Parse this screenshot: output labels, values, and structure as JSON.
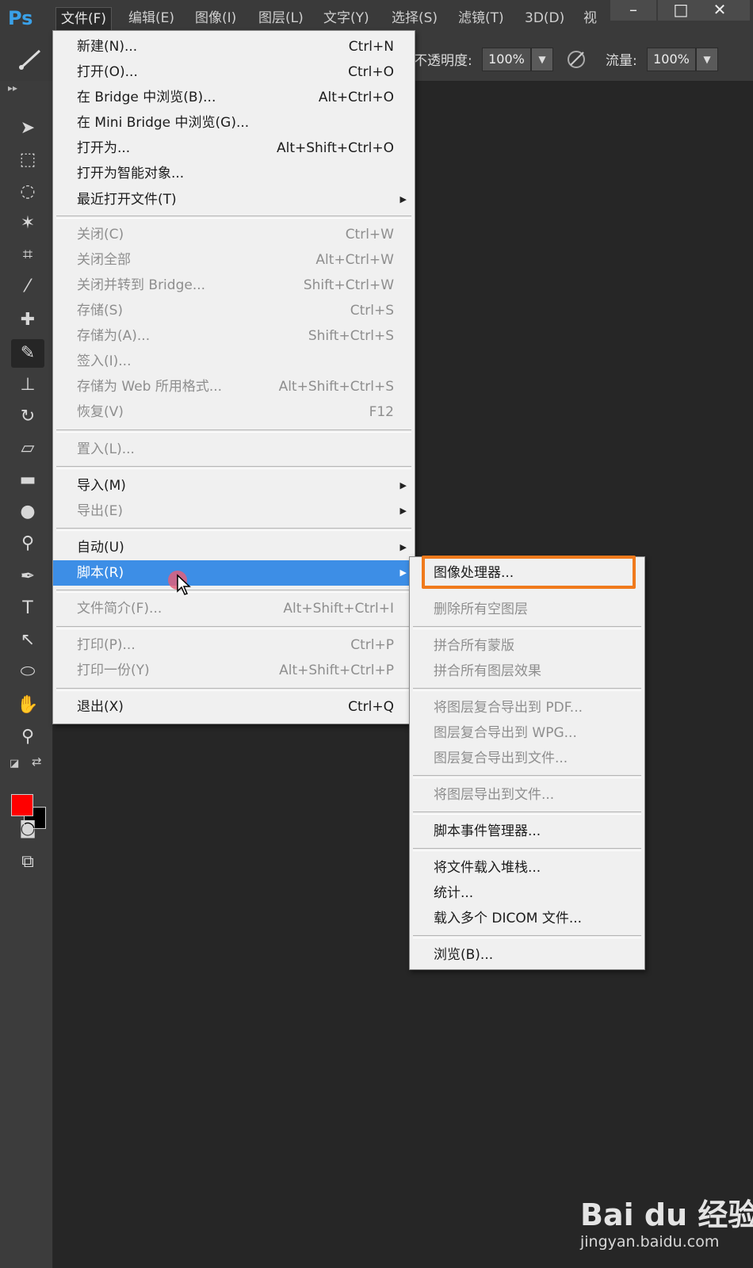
{
  "app": {
    "logo": "Ps"
  },
  "menubar": {
    "items": [
      "文件(F)",
      "编辑(E)",
      "图像(I)",
      "图层(L)",
      "文字(Y)",
      "选择(S)",
      "滤镜(T)",
      "3D(D)",
      "视"
    ],
    "active_index": 0
  },
  "window_controls": {
    "minimize": "–",
    "maximize": "□",
    "close": "✕"
  },
  "options_bar": {
    "opacity_label": "不透明度:",
    "opacity_value": "100%",
    "flow_label": "流量:",
    "flow_value": "100%"
  },
  "file_menu": {
    "items": [
      {
        "label": "新建(N)...",
        "shortcut": "Ctrl+N"
      },
      {
        "label": "打开(O)...",
        "shortcut": "Ctrl+O"
      },
      {
        "label": "在 Bridge 中浏览(B)...",
        "shortcut": "Alt+Ctrl+O"
      },
      {
        "label": "在 Mini Bridge 中浏览(G)...",
        "shortcut": ""
      },
      {
        "label": "打开为...",
        "shortcut": "Alt+Shift+Ctrl+O"
      },
      {
        "label": "打开为智能对象...",
        "shortcut": ""
      },
      {
        "label": "最近打开文件(T)",
        "shortcut": "",
        "submenu": true
      },
      {
        "label": "关闭(C)",
        "shortcut": "Ctrl+W",
        "disabled": true
      },
      {
        "label": "关闭全部",
        "shortcut": "Alt+Ctrl+W",
        "disabled": true
      },
      {
        "label": "关闭并转到 Bridge...",
        "shortcut": "Shift+Ctrl+W",
        "disabled": true
      },
      {
        "label": "存储(S)",
        "shortcut": "Ctrl+S",
        "disabled": true
      },
      {
        "label": "存储为(A)...",
        "shortcut": "Shift+Ctrl+S",
        "disabled": true
      },
      {
        "label": "签入(I)...",
        "shortcut": "",
        "disabled": true
      },
      {
        "label": "存储为 Web 所用格式...",
        "shortcut": "Alt+Shift+Ctrl+S",
        "disabled": true
      },
      {
        "label": "恢复(V)",
        "shortcut": "F12",
        "disabled": true
      },
      {
        "label": "置入(L)...",
        "shortcut": "",
        "disabled": true
      },
      {
        "label": "导入(M)",
        "shortcut": "",
        "submenu": true
      },
      {
        "label": "导出(E)",
        "shortcut": "",
        "submenu": true,
        "disabled": true
      },
      {
        "label": "自动(U)",
        "shortcut": "",
        "submenu": true
      },
      {
        "label": "脚本(R)",
        "shortcut": "",
        "submenu": true,
        "highlighted": true
      },
      {
        "label": "文件简介(F)...",
        "shortcut": "Alt+Shift+Ctrl+I",
        "disabled": true
      },
      {
        "label": "打印(P)...",
        "shortcut": "Ctrl+P",
        "disabled": true
      },
      {
        "label": "打印一份(Y)",
        "shortcut": "Alt+Shift+Ctrl+P",
        "disabled": true
      },
      {
        "label": "退出(X)",
        "shortcut": "Ctrl+Q"
      }
    ]
  },
  "scripts_submenu": {
    "items": [
      {
        "label": "图像处理器...",
        "highlighted_box": true
      },
      {
        "label": "删除所有空图层",
        "disabled": true
      },
      {
        "label": "拼合所有蒙版",
        "disabled": true
      },
      {
        "label": "拼合所有图层效果",
        "disabled": true
      },
      {
        "label": "将图层复合导出到 PDF...",
        "disabled": true
      },
      {
        "label": "图层复合导出到 WPG...",
        "disabled": true
      },
      {
        "label": "图层复合导出到文件...",
        "disabled": true
      },
      {
        "label": "将图层导出到文件...",
        "disabled": true
      },
      {
        "label": "脚本事件管理器..."
      },
      {
        "label": "将文件载入堆栈..."
      },
      {
        "label": "统计..."
      },
      {
        "label": "载入多个 DICOM 文件..."
      },
      {
        "label": "浏览(B)..."
      }
    ]
  },
  "colors": {
    "foreground": "#ff0000",
    "background": "#000000",
    "menu_highlight": "#3d8ee6",
    "annotation_box": "#f07a1c"
  },
  "watermark": {
    "logo": "Bai du 经验",
    "url": "jingyan.baidu.com"
  }
}
